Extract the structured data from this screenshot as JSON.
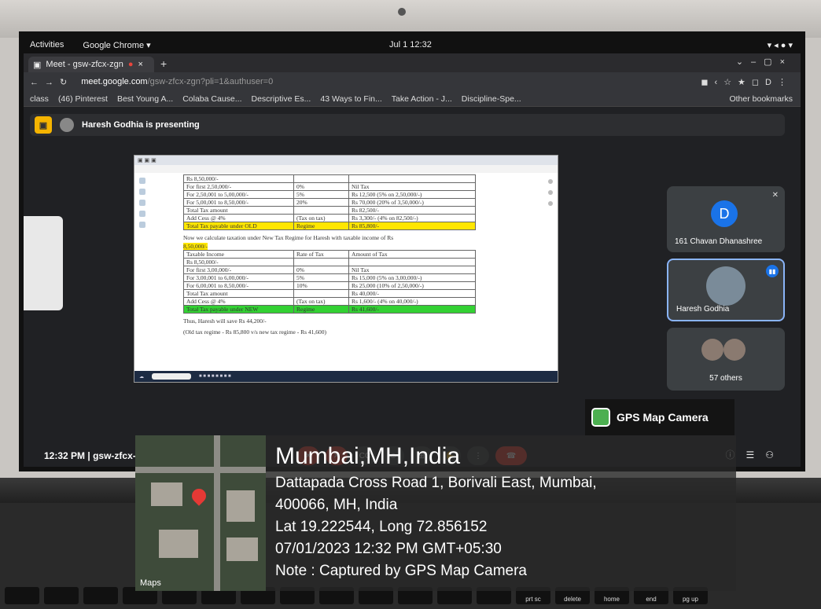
{
  "os_bar": {
    "activities": "Activities",
    "app_menu": "Google Chrome ▾",
    "clock": "Jul 1  12:32"
  },
  "browser": {
    "tab_title": "Meet - gsw-zfcx-zgn",
    "url_host": "meet.google.com",
    "url_path": "/gsw-zfcx-zgn?pli=1&authuser=0",
    "bookmarks": [
      "class",
      "(46) Pinterest",
      "Best Young A...",
      "Colaba Cause...",
      "Descriptive Es...",
      "43 Ways to Fin...",
      "Take Action - J...",
      "Discipline-Spe..."
    ],
    "other_bookmarks": "Other bookmarks"
  },
  "meet": {
    "presenter_banner": "Haresh Godhia is presenting",
    "meeting_time": "12:32 PM",
    "meeting_code": "gsw-zfcx-zgn",
    "participants": [
      {
        "initial": "D",
        "name": "161 Chavan Dhanashree"
      },
      {
        "name": "Haresh Godhia"
      },
      {
        "name": "57 others"
      }
    ]
  },
  "shared_doc": {
    "old_rows": [
      [
        "Rs 8,50,000/-",
        "",
        ""
      ],
      [
        "For first 2,50,000/-",
        "0%",
        "Nil Tax"
      ],
      [
        "For 2,50,001 to 5,00,000/-",
        "5%",
        "Rs 12,500 (5% on 2,50,000/-)"
      ],
      [
        "For 5,00,001 to 8,50,000/-",
        "20%",
        "Rs 70,000 (20% of 3,50,000/-)"
      ],
      [
        "Total Tax amount",
        "",
        "Rs 82,500/-"
      ],
      [
        "Add Cess @ 4%",
        "(Tax on tax)",
        "Rs  3,300/- (4% on 82,500/-)"
      ],
      [
        "Total Tax payable under OLD",
        "Regime",
        "Rs 85,800/-"
      ]
    ],
    "new_intro": "Now we calculate taxation under New Tax Regime for Haresh with taxable income of Rs",
    "new_income": "8,50,000/-",
    "new_header": [
      "Taxable Income",
      "Rate of Tax",
      "Amount of Tax"
    ],
    "new_rows": [
      [
        "Rs 8,50,000/-",
        "",
        ""
      ],
      [
        "For first 3,00,000/-",
        "0%",
        "Nil Tax"
      ],
      [
        "For 3,00,001 to 6,00,000/-",
        "5%",
        "Rs 15,000 (5% on 3,00,000/-)"
      ],
      [
        "For 6,00,001 to 8,50,000/-",
        "10%",
        "Rs 25,000 (10% of 2,50,000/-)"
      ],
      [
        "Total Tax amount",
        "",
        "Rs 40,000/-"
      ],
      [
        "Add Cess @ 4%",
        "(Tax on tax)",
        "Rs  1,600/- (4% on 40,000/-)"
      ],
      [
        "Total Tax payable under NEW",
        "Regime",
        "Rs 41,600/-"
      ]
    ],
    "conclusion1": "Thus, Haresh will save Rs 44,200/-",
    "conclusion2": "(Old tax regime - Rs 85,800 v/s new tax regime - Rs 41,600)"
  },
  "gps": {
    "badge": "GPS Map Camera",
    "city": "Mumbai,MH,India",
    "address1": "Dattapada Cross Road 1, Borivali East, Mumbai,",
    "address2": "400066, MH, India",
    "latlong": "Lat 19.222544, Long 72.856152",
    "datetime": "07/01/2023 12:32 PM GMT+05:30",
    "note": "Note : Captured by GPS Map Camera",
    "maps_label": "Maps"
  },
  "keyboard": {
    "keys": [
      "prt sc",
      "delete",
      "home",
      "end",
      "pg up"
    ]
  }
}
